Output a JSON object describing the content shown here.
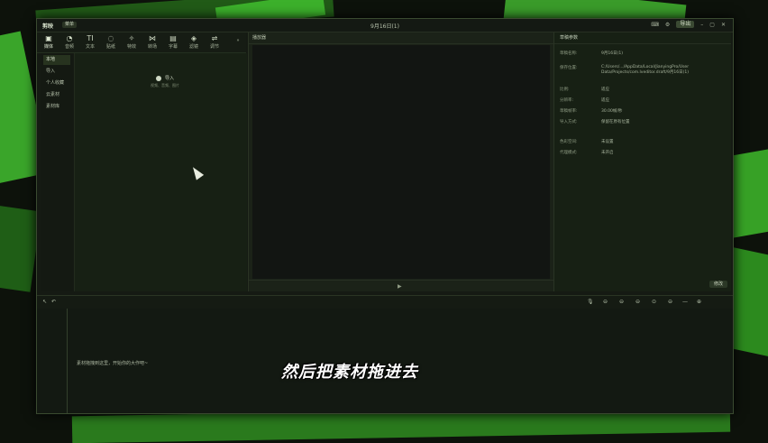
{
  "app": {
    "logo_text": "剪映",
    "menu_label": "菜单",
    "doc_title": "9月16日(1)",
    "export_label": "导出",
    "window_controls": [
      "minimize-icon",
      "maximize-icon",
      "close-icon"
    ]
  },
  "toolbar": {
    "tools": [
      {
        "label": "媒体",
        "icon": "media-icon"
      },
      {
        "label": "音频",
        "icon": "audio-icon"
      },
      {
        "label": "文本",
        "icon": "text-icon"
      },
      {
        "label": "贴纸",
        "icon": "sticker-icon"
      },
      {
        "label": "特效",
        "icon": "effects-icon"
      },
      {
        "label": "转场",
        "icon": "transition-icon"
      },
      {
        "label": "字幕",
        "icon": "caption-icon"
      },
      {
        "label": "滤镜",
        "icon": "filter-icon"
      },
      {
        "label": "调节",
        "icon": "adjust-icon"
      }
    ],
    "expand_icon": "chevron-right-icon"
  },
  "sidebar": {
    "items": [
      {
        "label": "本地"
      },
      {
        "label": "导入"
      },
      {
        "label": "个人收藏"
      },
      {
        "label": "云素材"
      },
      {
        "label": "素材库"
      }
    ]
  },
  "media": {
    "import_label": "导入",
    "import_sub": "视频、音频、图片"
  },
  "player": {
    "title": "播放器"
  },
  "props": {
    "title": "草稿参数",
    "rows": [
      {
        "key": "草稿名称:",
        "value": "9月16日(1)"
      },
      {
        "key": "保存位置:",
        "value": "C:/Users/.../AppData/Local/JianyingPro/User Data/Projects/com.lveditor.draft/9月16日(1)"
      },
      {
        "key": "比例:",
        "value": "适应"
      },
      {
        "key": "分辨率:",
        "value": "适应"
      },
      {
        "key": "草稿帧率:",
        "value": "30.00帧/秒"
      },
      {
        "key": "导入方式:",
        "value": "保留在原有位置"
      },
      {
        "key": "色彩空间:",
        "value": "未设置"
      },
      {
        "key": "代理模式:",
        "value": "未开启"
      }
    ],
    "modify_label": "修改"
  },
  "timeline": {
    "hint": "素材拖拽到这里，开始你的大作吧~"
  },
  "caption": {
    "text": "然后把素材拖进去"
  }
}
